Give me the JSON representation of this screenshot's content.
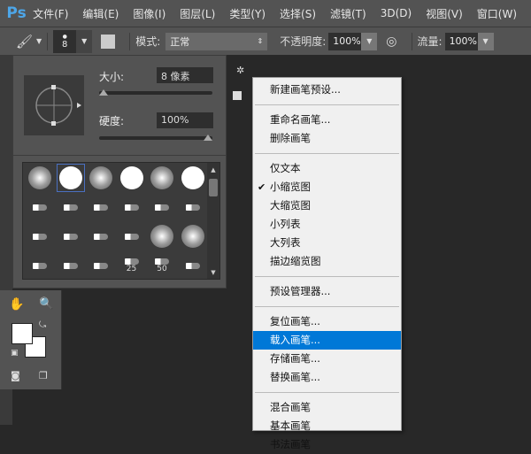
{
  "app": {
    "logo": "Ps"
  },
  "menubar": [
    "文件(F)",
    "编辑(E)",
    "图像(I)",
    "图层(L)",
    "类型(Y)",
    "选择(S)",
    "滤镜(T)",
    "3D(D)",
    "视图(V)",
    "窗口(W)"
  ],
  "options": {
    "brush_size": "8",
    "mode_label": "模式:",
    "mode_value": "正常",
    "opacity_label": "不透明度:",
    "opacity_value": "100%",
    "flow_label": "流量:",
    "flow_value": "100%"
  },
  "brush_panel": {
    "size_label": "大小:",
    "size_value": "8 像素",
    "size_fraction": 0.0,
    "hardness_label": "硬度:",
    "hardness_value": "100%",
    "hardness_fraction": 1.0,
    "presets": [
      {
        "type": "soft"
      },
      {
        "type": "hard",
        "selected": true
      },
      {
        "type": "soft"
      },
      {
        "type": "hard"
      },
      {
        "type": "soft"
      },
      {
        "type": "hard"
      },
      {
        "type": "tip"
      },
      {
        "type": "tip"
      },
      {
        "type": "tip"
      },
      {
        "type": "tip"
      },
      {
        "type": "tip"
      },
      {
        "type": "tip"
      },
      {
        "type": "tip"
      },
      {
        "type": "tip"
      },
      {
        "type": "tip"
      },
      {
        "type": "tip"
      },
      {
        "type": "soft"
      },
      {
        "type": "soft"
      },
      {
        "type": "tip"
      },
      {
        "type": "tip"
      },
      {
        "type": "tip"
      },
      {
        "type": "tip",
        "label": "25"
      },
      {
        "type": "tip",
        "label": "50"
      },
      {
        "type": "tip"
      }
    ]
  },
  "context_menu": [
    {
      "label": "新建画笔预设..."
    },
    {
      "sep": true
    },
    {
      "label": "重命名画笔..."
    },
    {
      "label": "删除画笔"
    },
    {
      "sep": true
    },
    {
      "label": "仅文本"
    },
    {
      "label": "小缩览图",
      "checked": true
    },
    {
      "label": "大缩览图"
    },
    {
      "label": "小列表"
    },
    {
      "label": "大列表"
    },
    {
      "label": "描边缩览图"
    },
    {
      "sep": true
    },
    {
      "label": "预设管理器..."
    },
    {
      "sep": true
    },
    {
      "label": "复位画笔..."
    },
    {
      "label": "载入画笔...",
      "highlighted": true
    },
    {
      "label": "存储画笔..."
    },
    {
      "label": "替换画笔..."
    },
    {
      "sep": true
    },
    {
      "label": "混合画笔"
    },
    {
      "label": "基本画笔"
    },
    {
      "label": "书法画笔"
    }
  ],
  "colors": {
    "highlight": "#0078d7",
    "logo": "#4da6e8"
  }
}
